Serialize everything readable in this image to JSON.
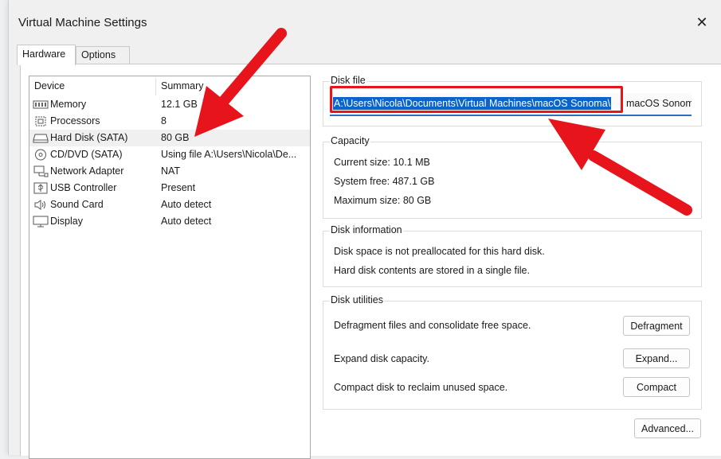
{
  "window": {
    "title": "Virtual Machine Settings"
  },
  "tabs": [
    {
      "label": "Hardware",
      "active": true
    },
    {
      "label": "Options",
      "active": false
    }
  ],
  "device_list": {
    "headers": {
      "device": "Device",
      "summary": "Summary"
    },
    "rows": [
      {
        "icon": "memory-icon",
        "name": "Memory",
        "summary": "12.1 GB"
      },
      {
        "icon": "processor-icon",
        "name": "Processors",
        "summary": "8"
      },
      {
        "icon": "hard-disk-icon",
        "name": "Hard Disk (SATA)",
        "summary": "80 GB",
        "selected": true
      },
      {
        "icon": "cd-dvd-icon",
        "name": "CD/DVD (SATA)",
        "summary": "Using file A:\\Users\\Nicola\\De..."
      },
      {
        "icon": "network-adapter-icon",
        "name": "Network Adapter",
        "summary": "NAT"
      },
      {
        "icon": "usb-icon",
        "name": "USB Controller",
        "summary": "Present"
      },
      {
        "icon": "speaker-icon",
        "name": "Sound Card",
        "summary": "Auto detect"
      },
      {
        "icon": "display-icon",
        "name": "Display",
        "summary": "Auto detect"
      }
    ]
  },
  "disk_file": {
    "label": "Disk file",
    "selected_text": "A:\\Users\\Nicola\\Documents\\Virtual Machines\\macOS Sonoma\\",
    "trailing_text": "macOS Sonom"
  },
  "capacity": {
    "label": "Capacity",
    "current_size": "Current size: 10.1 MB",
    "system_free": "System free: 487.1 GB",
    "maximum_size": "Maximum size: 80 GB"
  },
  "disk_information": {
    "label": "Disk information",
    "line1": "Disk space is not preallocated for this hard disk.",
    "line2": "Hard disk contents are stored in a single file."
  },
  "disk_utilities": {
    "label": "Disk utilities",
    "defragment_text": "Defragment files and consolidate free space.",
    "defragment_button": "Defragment",
    "expand_text": "Expand disk capacity.",
    "expand_button": "Expand...",
    "compact_text": "Compact disk to reclaim unused space.",
    "compact_button": "Compact"
  },
  "advanced_button": "Advanced...",
  "colors": {
    "annotation": "#e8141c",
    "selection": "#0a64cc",
    "accent": "#2e6fbf"
  }
}
